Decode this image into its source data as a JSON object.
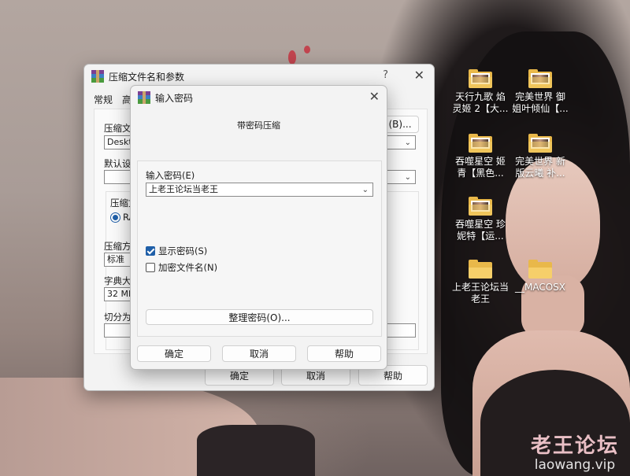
{
  "desktop": {
    "icons": [
      {
        "label_line1": "天行九歌 焰",
        "label_line2": "灵姬 2【大..."
      },
      {
        "label_line1": "完美世界 御",
        "label_line2": "姐叶倾仙【..."
      },
      {
        "label_line1": "吞噬星空 姬",
        "label_line2": "青【黑色..."
      },
      {
        "label_line1": "完美世界 新",
        "label_line2": "版云曦 补..."
      },
      {
        "label_line1": "吞噬星空 珍",
        "label_line2": "妮特【运..."
      },
      {
        "label_line1": "上老王论坛当",
        "label_line2": "老王"
      },
      {
        "label_line1": "__MACOSX",
        "label_line2": ""
      }
    ],
    "watermark": {
      "line1": "老王论坛",
      "line2": "laowang.vip"
    }
  },
  "archive_dialog": {
    "title": "压缩文件名和参数",
    "help": "?",
    "tabs": [
      "常规",
      "高"
    ],
    "labels": {
      "archive_name": "压缩文件",
      "default_profile": "默认设置",
      "archive_format": "压缩文",
      "compression_method": "压缩方式",
      "dictionary_size": "字典大小",
      "split_volumes": "切分为分"
    },
    "values": {
      "archive_path": "Deskto",
      "format_option": "RA",
      "compression_method": "标准",
      "dictionary_size": "32 MB"
    },
    "browse_button": "(B)...",
    "buttons": {
      "ok": "确定",
      "cancel": "取消",
      "help": "帮助"
    }
  },
  "password_dialog": {
    "title": "输入密码",
    "subtitle": "带密码压缩",
    "password_label": "输入密码(E)",
    "password_value": "上老王论坛当老王",
    "show_password": {
      "label": "显示密码(S)",
      "checked": true
    },
    "encrypt_filenames": {
      "label": "加密文件名(N)",
      "checked": false
    },
    "organize_button": "整理密码(O)...",
    "buttons": {
      "ok": "确定",
      "cancel": "取消",
      "help": "帮助"
    }
  }
}
